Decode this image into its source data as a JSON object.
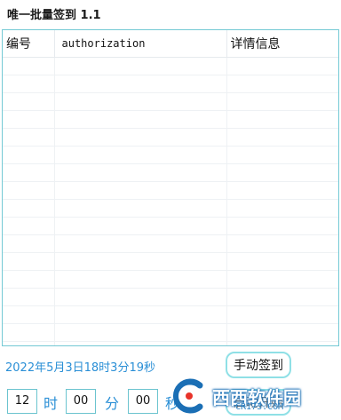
{
  "title": "唯一批量签到 1.1",
  "table": {
    "columns": [
      "编号",
      "authorization",
      "详情信息"
    ],
    "empty_rows": 17
  },
  "datetime": "2022年5月3日18时3分19秒",
  "buttons": {
    "manual_sign": "手动签到",
    "start": "启动开始"
  },
  "schedule": {
    "hour": "12",
    "minute": "00",
    "second": "00",
    "hour_unit": "时",
    "minute_unit": "分",
    "second_unit": "秒"
  },
  "watermark": {
    "text": "西西软件园",
    "sub": "CR173.COM"
  }
}
